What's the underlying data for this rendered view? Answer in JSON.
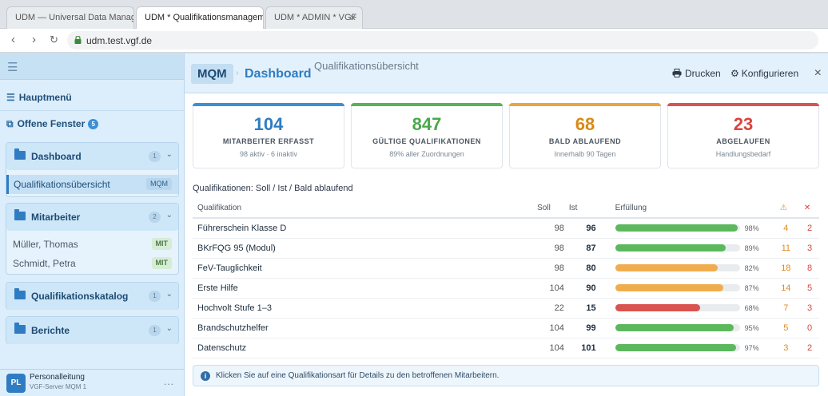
{
  "browser": {
    "tabs": [
      {
        "label": "UDM — Universal Data Manag..."
      },
      {
        "label": "UDM * Qualifikationsmanageme"
      },
      {
        "label": "UDM * ADMIN * VGF"
      }
    ],
    "url": "udm.test.vgf.de"
  },
  "sidebar": {
    "menu_icon": "☰",
    "hauptmenu": "Hauptmenü",
    "offene_fenster": "Offene Fenster",
    "offene_fenster_count": "5",
    "groups": [
      {
        "title": "Dashboard",
        "count": "1",
        "items": [
          {
            "label": "Qualifikationsübersicht",
            "tag": "MQM"
          }
        ]
      },
      {
        "title": "Mitarbeiter",
        "count": "2",
        "items": [
          {
            "label": "Müller, Thomas",
            "tag": "MIT"
          },
          {
            "label": "Schmidt, Petra",
            "tag": "MIT"
          }
        ]
      },
      {
        "title": "Qualifikationskatalog",
        "count": "1",
        "items": []
      },
      {
        "title": "Berichte",
        "count": "1",
        "items": []
      }
    ],
    "footer": {
      "initials": "PL",
      "name": "Personalleitung",
      "sub": "VGF-Server MQM 1",
      "more": "..."
    }
  },
  "header": {
    "mqm": "MQM",
    "sep": "›",
    "title": "Dashboard",
    "subtitle": "Qualifikationsübersicht",
    "print_label": "Drucken",
    "configure_label": "Konfigurieren",
    "close": "×"
  },
  "cards": [
    {
      "value": "104",
      "label": "MITARBEITER ERFASST",
      "sub": "98 aktiv · 6 inaktiv",
      "color": "#2f7cc3",
      "bar": "#3b8fd6"
    },
    {
      "value": "847",
      "label": "GÜLTIGE QUALIFIKATIONEN",
      "sub": "89% aller Zuordnungen",
      "color": "#4aa84a",
      "bar": "#58b258"
    },
    {
      "value": "68",
      "label": "BALD ABLAUFEND",
      "sub": "Innerhalb 90 Tagen",
      "color": "#d88a15",
      "bar": "#e8a640"
    },
    {
      "value": "23",
      "label": "ABGELAUFEN",
      "sub": "Handlungsbedarf",
      "color": "#d9443c",
      "bar": "#d9534f"
    }
  ],
  "section_title": "Qualifikationen: Soll / Ist / Bald ablaufend",
  "table": {
    "headers": {
      "name": "Qualifikation",
      "soll": "Soll",
      "ist": "Ist",
      "fulfil": "Erfüllung",
      "warn": "⚠",
      "exp": "✕"
    },
    "rows": [
      {
        "name": "Führerschein Klasse D",
        "soll": "98",
        "ist": "96",
        "pct": "98%",
        "fraction": 0.98,
        "color": "#5cb85c",
        "warn": "4",
        "exp": "2"
      },
      {
        "name": "BKrFQG 95 (Modul)",
        "soll": "98",
        "ist": "87",
        "pct": "89%",
        "fraction": 0.89,
        "color": "#5cb85c",
        "warn": "11",
        "exp": "3"
      },
      {
        "name": "FeV-Tauglichkeit",
        "soll": "98",
        "ist": "80",
        "pct": "82%",
        "fraction": 0.82,
        "color": "#f0ad4e",
        "warn": "18",
        "exp": "8"
      },
      {
        "name": "Erste Hilfe",
        "soll": "104",
        "ist": "90",
        "pct": "87%",
        "fraction": 0.87,
        "color": "#f0ad4e",
        "warn": "14",
        "exp": "5"
      },
      {
        "name": "Hochvolt Stufe 1–3",
        "soll": "22",
        "ist": "15",
        "pct": "68%",
        "fraction": 0.68,
        "color": "#d9534f",
        "warn": "7",
        "exp": "3"
      },
      {
        "name": "Brandschutzhelfer",
        "soll": "104",
        "ist": "99",
        "pct": "95%",
        "fraction": 0.95,
        "color": "#5cb85c",
        "warn": "5",
        "exp": "0"
      },
      {
        "name": "Datenschutz",
        "soll": "104",
        "ist": "101",
        "pct": "97%",
        "fraction": 0.97,
        "color": "#5cb85c",
        "warn": "3",
        "exp": "2"
      }
    ]
  },
  "info": "Klicken Sie auf eine Qualifikationsart für Details zu den betroffenen Mitarbeitern."
}
